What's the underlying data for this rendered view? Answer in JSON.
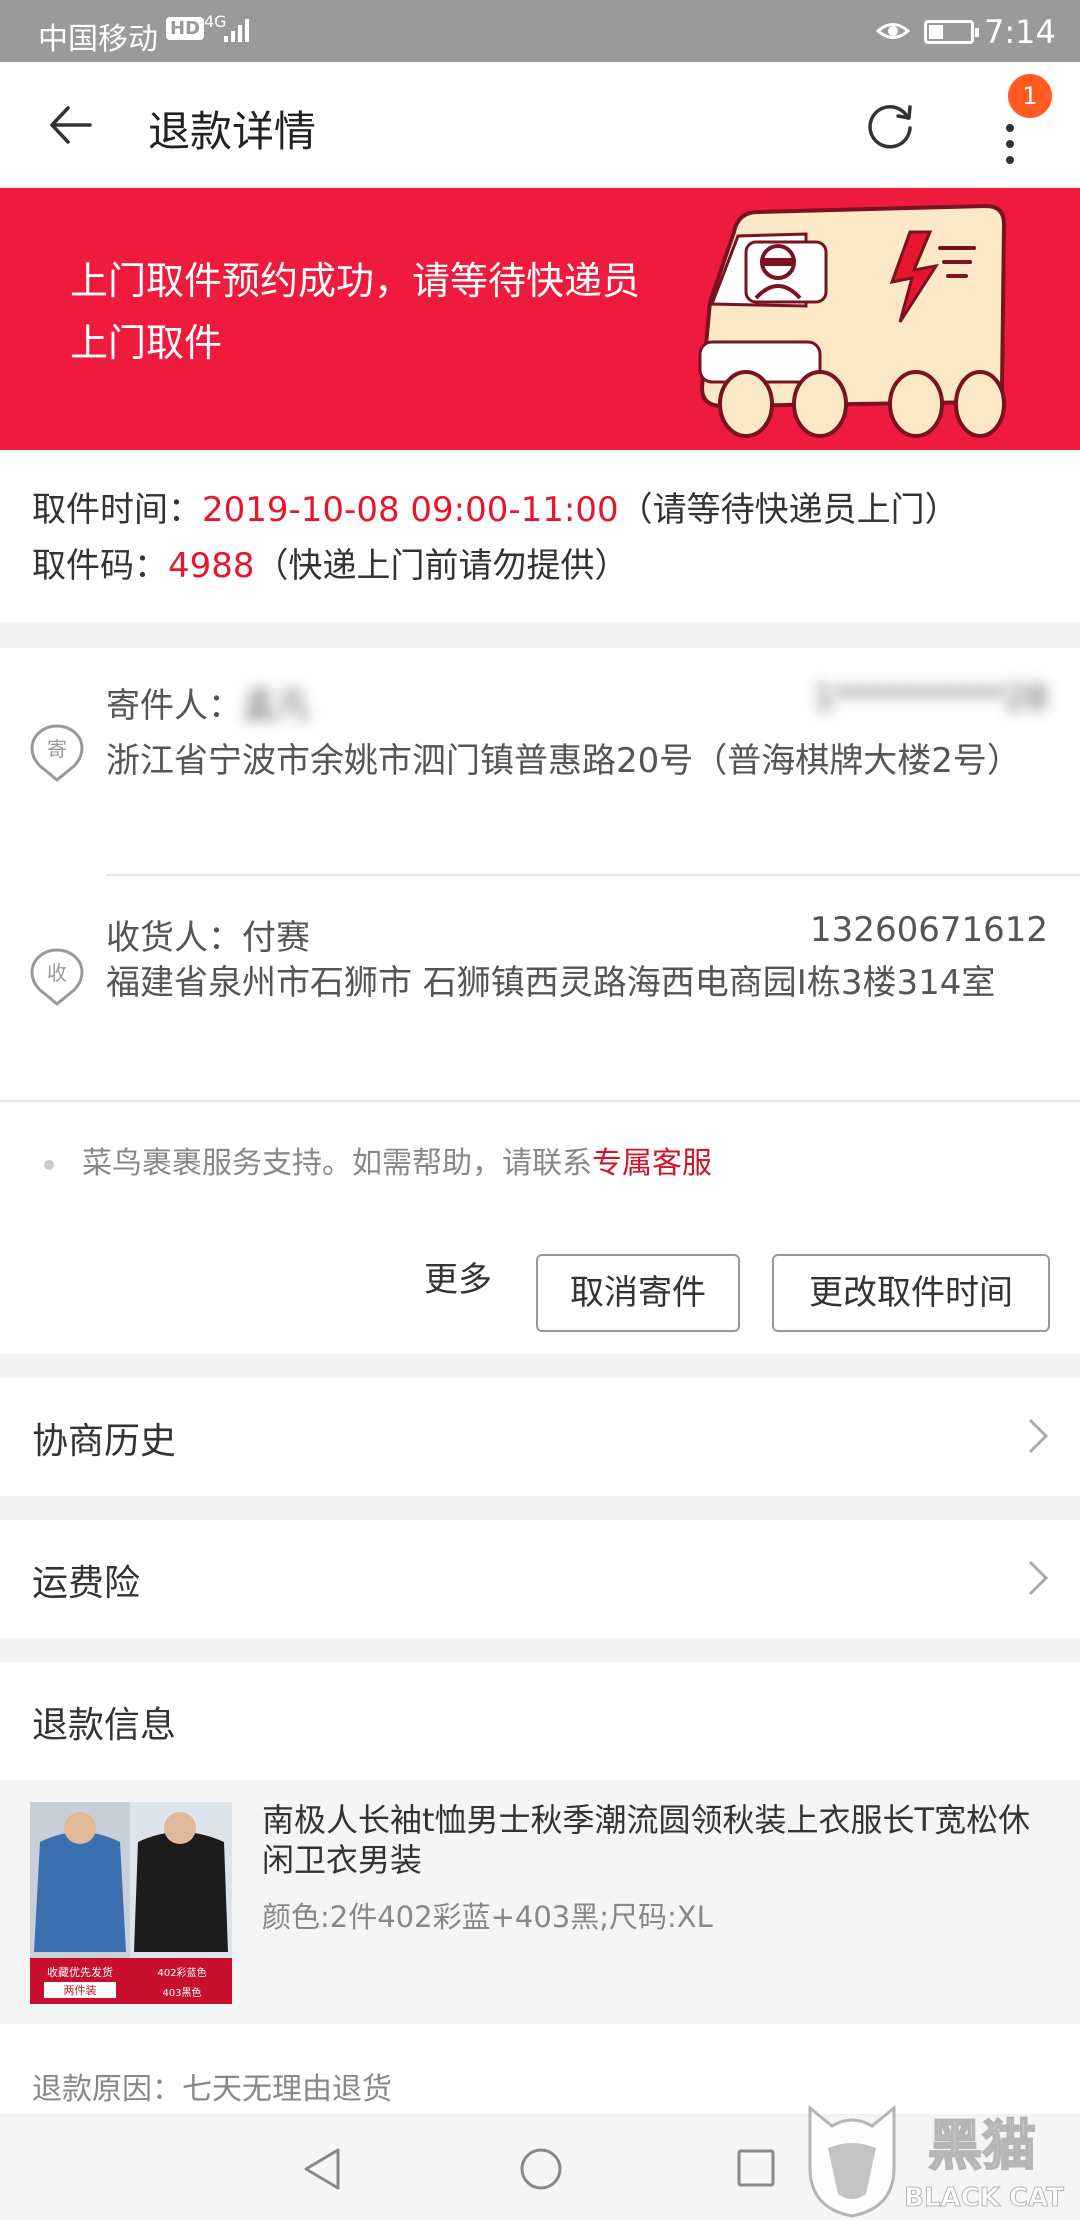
{
  "status_bar": {
    "carrier": "中国移动",
    "hd": "HD",
    "network": "4G",
    "time": "7:14"
  },
  "header": {
    "title": "退款详情",
    "badge_count": "1"
  },
  "banner": {
    "message": "上门取件预约成功，请等待快递员上门取件"
  },
  "pickup": {
    "time_label": "取件时间：",
    "time_value": "2019-10-08 09:00-11:00",
    "time_note": "（请等待快递员上门）",
    "code_label": "取件码：",
    "code_value": "4988",
    "code_note": "（快递上门前请勿提供）"
  },
  "sender": {
    "icon_char": "寄",
    "label": "寄件人：",
    "name": "孟凡",
    "phone": "1**********28",
    "address": "浙江省宁波市余姚市泗门镇普惠路20号（普海棋牌大楼2号）"
  },
  "receiver": {
    "icon_char": "收",
    "label": "收货人：",
    "name": "付赛",
    "phone": "13260671612",
    "address": "福建省泉州市石狮市 石狮镇西灵路海西电商园I栋3楼314室"
  },
  "service": {
    "text": "菜鸟裹裹服务支持。如需帮助，请联系",
    "link": "专属客服"
  },
  "actions": {
    "more": "更多",
    "cancel": "取消寄件",
    "change_time": "更改取件时间"
  },
  "rows": {
    "history": "协商历史",
    "insurance": "运费险"
  },
  "refund": {
    "title": "退款信息",
    "product_name": "南极人长袖t恤男士秋季潮流圆领秋装上衣服长T宽松休闲卫衣男装",
    "spec": "颜色:2件402彩蓝+403黑;尺码:XL",
    "thumb_tag_1": "收藏优先发货",
    "thumb_tag_2": "两件装",
    "thumb_tag_3": "402彩蓝色",
    "thumb_tag_4": "403黑色",
    "reason": "退款原因：七天无理由退货"
  },
  "watermark": {
    "cn": "黑猫",
    "en": "BLACK CAT"
  },
  "colors": {
    "brand_red": "#ee1b3e",
    "text_red": "#e8152f",
    "badge_orange": "#ff5a1f"
  }
}
